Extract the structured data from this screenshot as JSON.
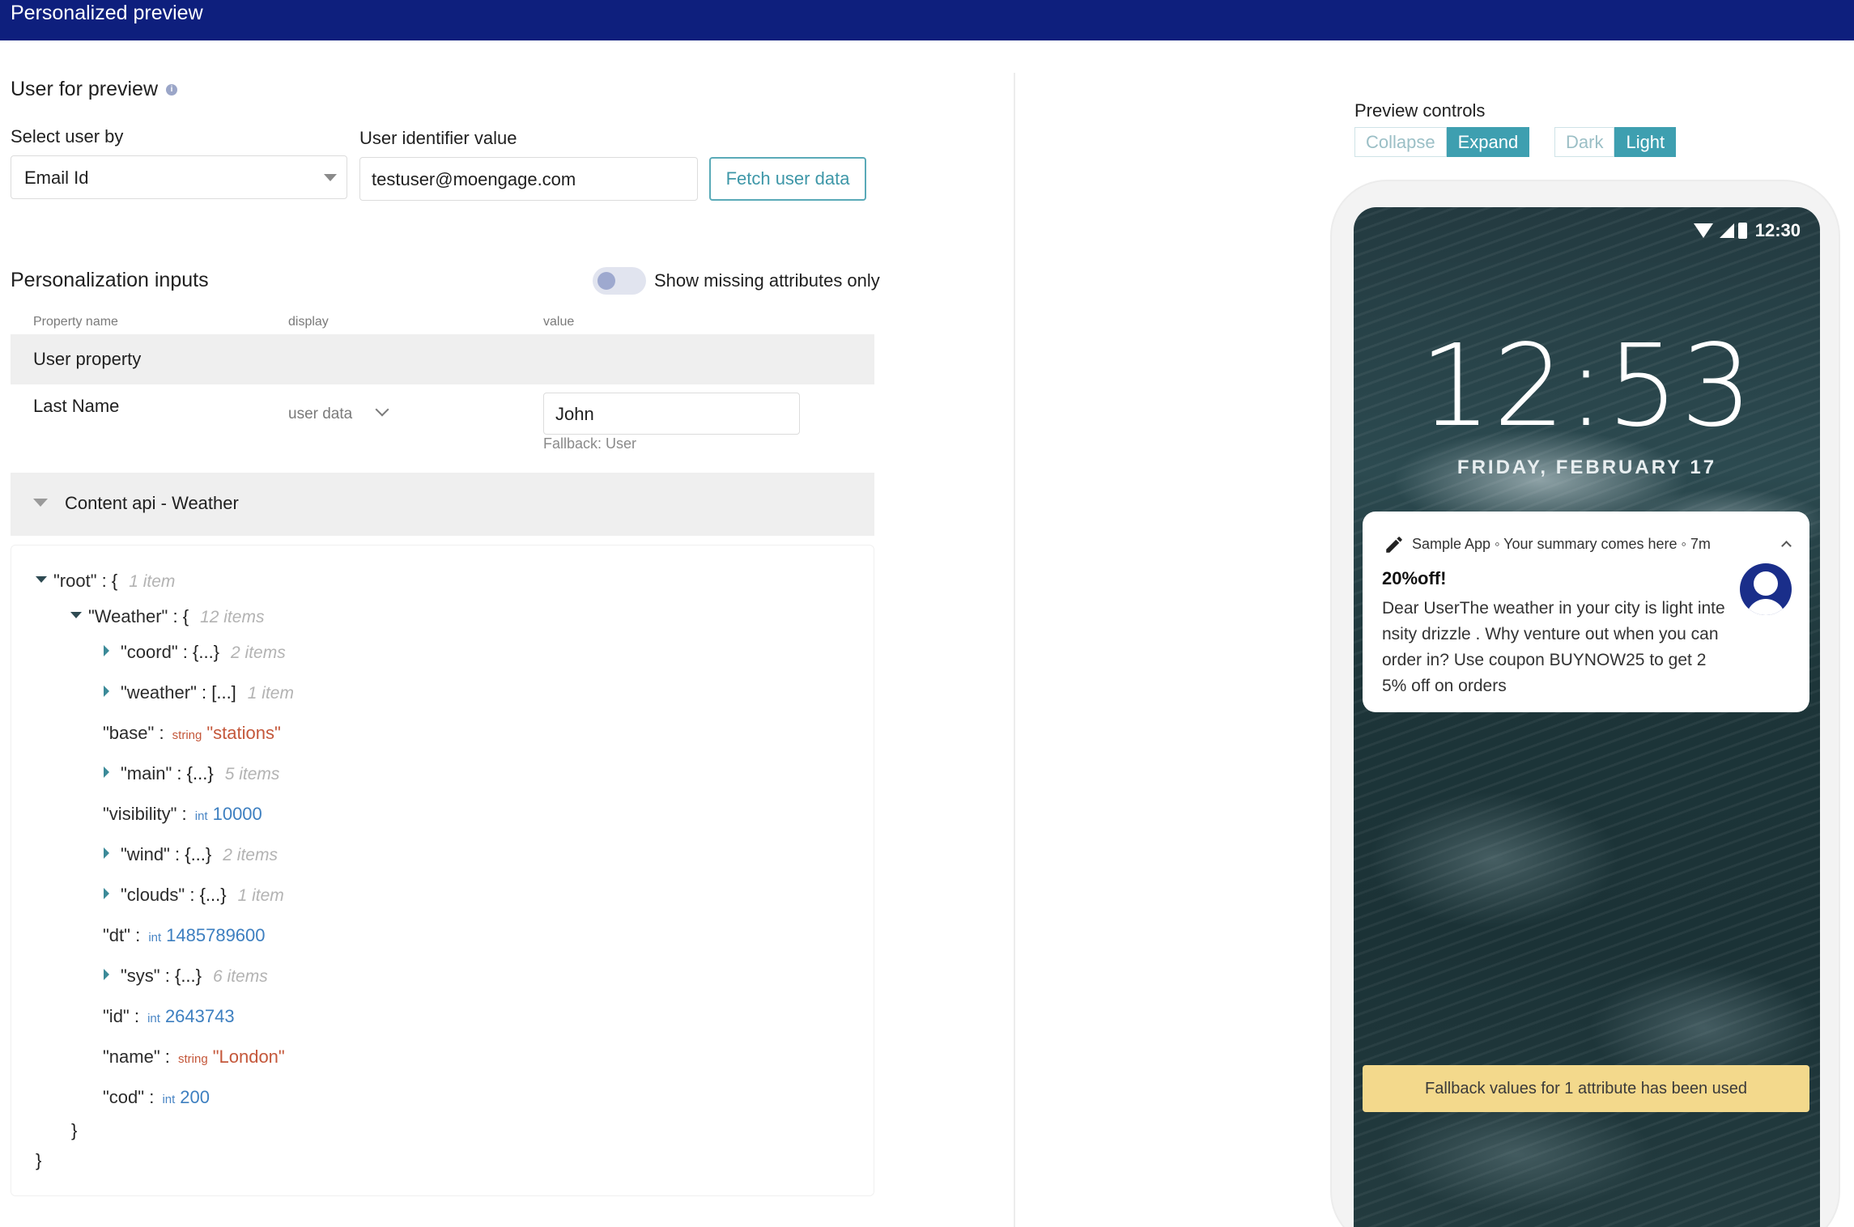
{
  "header": {
    "title": "Personalized preview"
  },
  "user_preview": {
    "title": "User for preview",
    "select_label": "Select user by",
    "select_value": "Email Id",
    "identifier_label": "User identifier value",
    "identifier_value": "testuser@moengage.com",
    "fetch_button": "Fetch user data"
  },
  "personalization": {
    "title": "Personalization inputs",
    "toggle_label": "Show missing attributes only",
    "columns": [
      "Property name",
      "display",
      "value"
    ],
    "user_property_group": "User property",
    "row": {
      "name": "Last Name",
      "display": "user data",
      "value": "John",
      "fallback": "Fallback: User"
    },
    "content_api_group": "Content api - Weather"
  },
  "json_tree": {
    "root_key": "\"root\"",
    "root_meta": "1 item",
    "weather_key": "\"Weather\"",
    "weather_meta": "12 items",
    "lines": [
      {
        "key": "\"coord\"",
        "collapsed": "{...}",
        "meta": "2 items"
      },
      {
        "key": "\"weather\"",
        "collapsed": "[...]",
        "meta": "1 item"
      },
      {
        "key": "\"base\"",
        "type": "string",
        "value": "\"stations\""
      },
      {
        "key": "\"main\"",
        "collapsed": "{...}",
        "meta": "5 items"
      },
      {
        "key": "\"visibility\"",
        "type": "int",
        "value": "10000"
      },
      {
        "key": "\"wind\"",
        "collapsed": "{...}",
        "meta": "2 items"
      },
      {
        "key": "\"clouds\"",
        "collapsed": "{...}",
        "meta": "1 item"
      },
      {
        "key": "\"dt\"",
        "type": "int",
        "value": "1485789600"
      },
      {
        "key": "\"sys\"",
        "collapsed": "{...}",
        "meta": "6 items"
      },
      {
        "key": "\"id\"",
        "type": "int",
        "value": "2643743"
      },
      {
        "key": "\"name\"",
        "type": "string",
        "value": "\"London\""
      },
      {
        "key": "\"cod\"",
        "type": "int",
        "value": "200"
      }
    ]
  },
  "preview_controls": {
    "label": "Preview controls",
    "collapse": "Collapse",
    "expand": "Expand",
    "dark": "Dark",
    "light": "Light",
    "active_size": "Expand",
    "active_theme": "Light",
    "accent_color": "#3e9fb0"
  },
  "phone": {
    "status_time": "12:30",
    "clock": "12:53",
    "date": "FRIDAY, FEBRUARY 17",
    "notification": {
      "meta": "Sample App ◦ Your summary comes here ◦ 7m",
      "title": "20%off!",
      "body": "Dear UserThe weather in your city is light intensity drizzle . Why venture out when you can order in? Use coupon BUYNOW25 to get 25% off on orders"
    },
    "fallback_banner": "Fallback values for 1 attribute has been used"
  },
  "colors": {
    "header_bg": "#0e1f7d",
    "banner_bg": "#f3d98c",
    "string_color": "#c4573a",
    "int_color": "#3d7fc0"
  }
}
